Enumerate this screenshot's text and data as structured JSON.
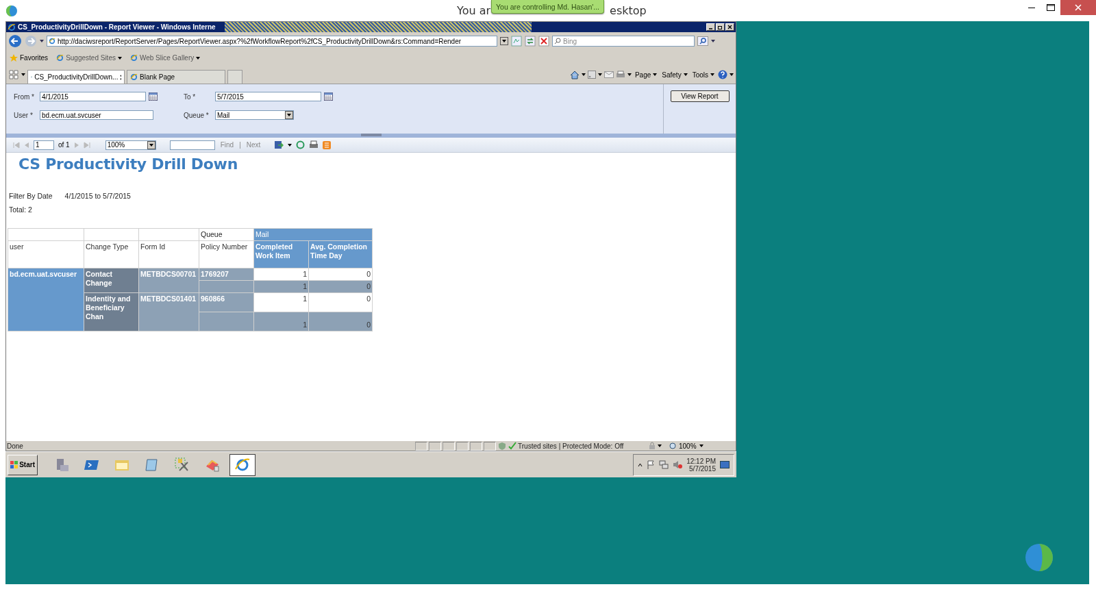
{
  "remote_title": {
    "visible_start": "You ar",
    "visible_end": "esktop"
  },
  "notice": "You are controlling Md. Hasan'...",
  "browser": {
    "title": "CS_ProductivityDrillDown - Report Viewer - Windows Interne",
    "address": "http://daciwsreport/ReportServer/Pages/ReportViewer.aspx?%2fWorkflowReport%2fCS_ProductivityDrillDown&rs:Command=Render",
    "search_placeholder": "Bing",
    "favorites": [
      {
        "label": "Favorites",
        "kind": "star"
      },
      {
        "label": "Suggested Sites",
        "kind": "menu"
      },
      {
        "label": "Web Slice Gallery",
        "kind": "menu"
      }
    ],
    "tabs": [
      {
        "label": "CS_ProductivityDrillDown...",
        "selected": true
      },
      {
        "label": "Blank Page",
        "selected": false
      }
    ],
    "commands": [
      "Page",
      "Safety",
      "Tools"
    ]
  },
  "parameters": [
    {
      "label": "From *",
      "value": "4/1/2015",
      "kind": "date"
    },
    {
      "label": "To *",
      "value": "5/7/2015",
      "kind": "date"
    },
    {
      "label": "User *",
      "value": "bd.ecm.uat.svcuser",
      "kind": "text"
    },
    {
      "label": "Queue *",
      "value": "Mail",
      "kind": "select"
    }
  ],
  "view_button": "View Report",
  "report_toolbar": {
    "page": "1",
    "page_count": "of 1",
    "zoom": "100%",
    "find": "Find",
    "separator": "|",
    "next": "Next"
  },
  "report": {
    "title": "CS Productivity Drill Down",
    "filter_label": "Filter By Date",
    "filter_value": "4/1/2015 to 5/7/2015",
    "total": "Total: 2",
    "table": {
      "queue_label": "Queue",
      "queue": "Mail",
      "columns": [
        "user",
        "Change Type",
        "Form Id",
        "Policy Number",
        "Completed Work Item",
        "Avg. Completion Time Day"
      ],
      "groups": [
        {
          "user": "bd.ecm.uat.svcuser",
          "items": [
            {
              "change_type": "Contact Change",
              "form_id": "METBDCS00701",
              "rows": [
                {
                  "kind": "detail",
                  "policy": "1769207",
                  "completed": "1",
                  "avg": "0"
                },
                {
                  "kind": "subtotal",
                  "completed": "1",
                  "avg": "0"
                }
              ]
            },
            {
              "change_type": "Indentity and Beneficiary Chan",
              "form_id": "METBDCS01401",
              "rows": [
                {
                  "kind": "detail",
                  "policy": "960866",
                  "completed": "1",
                  "avg": "0"
                },
                {
                  "kind": "subtotal",
                  "completed": "1",
                  "avg": "0"
                }
              ]
            }
          ]
        }
      ]
    }
  },
  "status_bar": {
    "text": "Done",
    "zone": "Trusted sites | Protected Mode: Off",
    "zoom": "100%"
  },
  "taskbar": {
    "start": "Start",
    "time": "12:12 PM",
    "date": "5/7/2015"
  }
}
